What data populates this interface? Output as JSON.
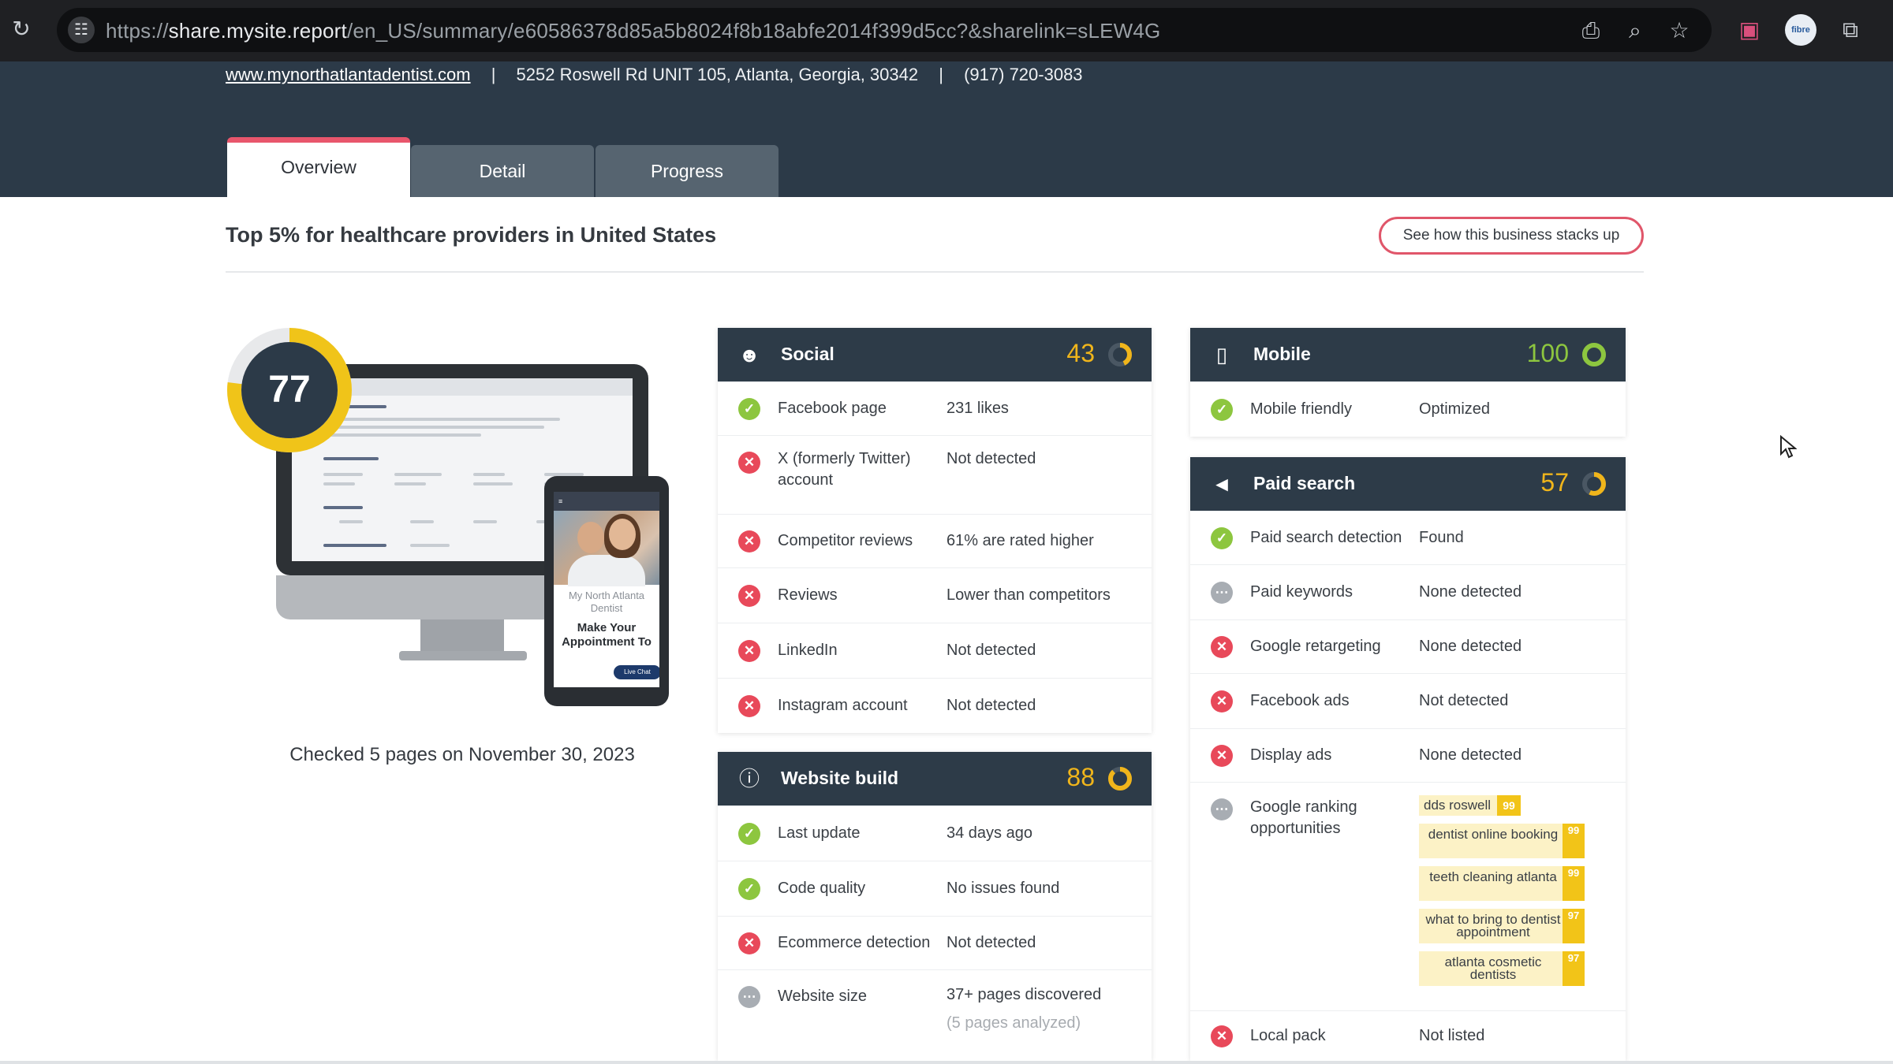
{
  "browser": {
    "url_prefix": "https://",
    "url_host": "share.mysite.report",
    "url_path": "/en_US/summary/e60586378d85a5b8024f8b18abfe2014f399d5cc?&sharelink=sLEW4G",
    "avatar_text": "fibre"
  },
  "business": {
    "website": "www.mynorthatlantadentist.com",
    "sep": "|",
    "address": "5252 Roswell Rd UNIT 105, Atlanta, Georgia, 30342",
    "phone": "(917) 720-3083"
  },
  "tabs": [
    {
      "label": "Overview"
    },
    {
      "label": "Detail"
    },
    {
      "label": "Progress"
    }
  ],
  "summary": {
    "rank_title": "Top 5% for healthcare providers in United States",
    "stacks_button": "See how this business stacks up",
    "overall_score": "77",
    "overall_fraction": 0.77,
    "checked_text": "Checked 5 pages on November 30, 2023"
  },
  "mockup": {
    "phone_brand": "My North Atlanta Dentist",
    "phone_heading": "Make Your Appointment To",
    "phone_chat": "Live Chat"
  },
  "social": {
    "title": "Social",
    "score": "43",
    "fraction": 0.43,
    "rows": [
      {
        "label": "Facebook page",
        "value": "231 likes"
      },
      {
        "label": "X (formerly Twitter) account",
        "value": "Not detected"
      },
      {
        "label": "Competitor reviews",
        "value": "61% are rated higher"
      },
      {
        "label": "Reviews",
        "value": "Lower than competitors"
      },
      {
        "label": "LinkedIn",
        "value": "Not detected"
      },
      {
        "label": "Instagram account",
        "value": "Not detected"
      }
    ]
  },
  "website_build": {
    "title": "Website build",
    "score": "88",
    "fraction": 0.88,
    "rows": [
      {
        "label": "Last update",
        "value": "34 days ago"
      },
      {
        "label": "Code quality",
        "value": "No issues found"
      },
      {
        "label": "Ecommerce detection",
        "value": "Not detected"
      },
      {
        "label": "Website size",
        "value": "37+ pages discovered",
        "sub": "(5 pages analyzed)"
      }
    ]
  },
  "mobile": {
    "title": "Mobile",
    "score": "100",
    "fraction": 1.0,
    "rows": [
      {
        "label": "Mobile friendly",
        "value": "Optimized"
      }
    ]
  },
  "paid_search": {
    "title": "Paid search",
    "score": "57",
    "fraction": 0.57,
    "rows": [
      {
        "label": "Paid search detection",
        "value": "Found"
      },
      {
        "label": "Paid keywords",
        "value": "None detected"
      },
      {
        "label": "Google retargeting",
        "value": "None detected"
      },
      {
        "label": "Facebook ads",
        "value": "Not detected"
      },
      {
        "label": "Display ads",
        "value": "None detected"
      },
      {
        "label": "Google ranking opportunities",
        "value": ""
      },
      {
        "label": "Local pack",
        "value": "Not listed"
      }
    ],
    "keywords": [
      {
        "text": "dds roswell",
        "rank": "99"
      },
      {
        "text": "dentist online booking",
        "rank": "99"
      },
      {
        "text": "teeth cleaning atlanta",
        "rank": "99"
      },
      {
        "text": "what to bring to dentist appointment",
        "rank": "97"
      },
      {
        "text": "atlanta cosmetic dentists",
        "rank": "97"
      }
    ]
  },
  "colors": {
    "header_bg": "#2c3a48",
    "accent_red": "#e8566c",
    "score_yellow": "#f0b51b",
    "score_green": "#8dc63f",
    "pass": "#8dc63f",
    "fail": "#e8495a"
  }
}
